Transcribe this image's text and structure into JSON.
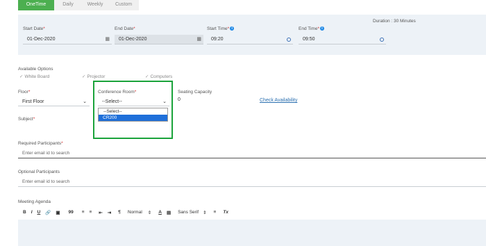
{
  "tabs": [
    {
      "label": "OneTime",
      "active": true
    },
    {
      "label": "Daily",
      "active": false
    },
    {
      "label": "Weekly",
      "active": false
    },
    {
      "label": "Custom",
      "active": false
    }
  ],
  "schedule": {
    "start_date_label": "Start Date",
    "start_date_value": "01-Dec-2020",
    "end_date_label": "End Date",
    "end_date_value": "01-Dec-2020",
    "start_time_label": "Start Time",
    "start_time_value": "09:20",
    "end_time_label": "End Time",
    "end_time_value": "09:50",
    "duration": "Duration : 30 Minutes"
  },
  "options": {
    "label": "Available Options",
    "items": [
      "White Board",
      "Projector",
      "Computers"
    ]
  },
  "floor": {
    "label": "Floor",
    "value": "First Floor"
  },
  "room": {
    "label": "Conference Room",
    "value": "--Select--",
    "options": [
      "--Select--",
      "CR200"
    ],
    "highlighted": "CR200"
  },
  "capacity": {
    "label": "Seating Capacity",
    "value": "0"
  },
  "check_availability": "Check Availability",
  "subject": {
    "label": "Subject"
  },
  "required": {
    "label": "Required Participants",
    "placeholder": "Enter email id to search"
  },
  "optional": {
    "label": "Optional Participants",
    "placeholder": "Enter email id to search"
  },
  "agenda": {
    "label": "Meeting Agenda",
    "toolbar": {
      "bold": "B",
      "italic": "I",
      "underline": "U",
      "quote": "99",
      "heading": "Normal",
      "font": "Sans Serif",
      "clear": "Tx"
    }
  },
  "colors": {
    "accent": "#4caf50",
    "highlight": "#1aa33a",
    "link": "#2a6fb0",
    "selected": "#1e6fd9"
  }
}
